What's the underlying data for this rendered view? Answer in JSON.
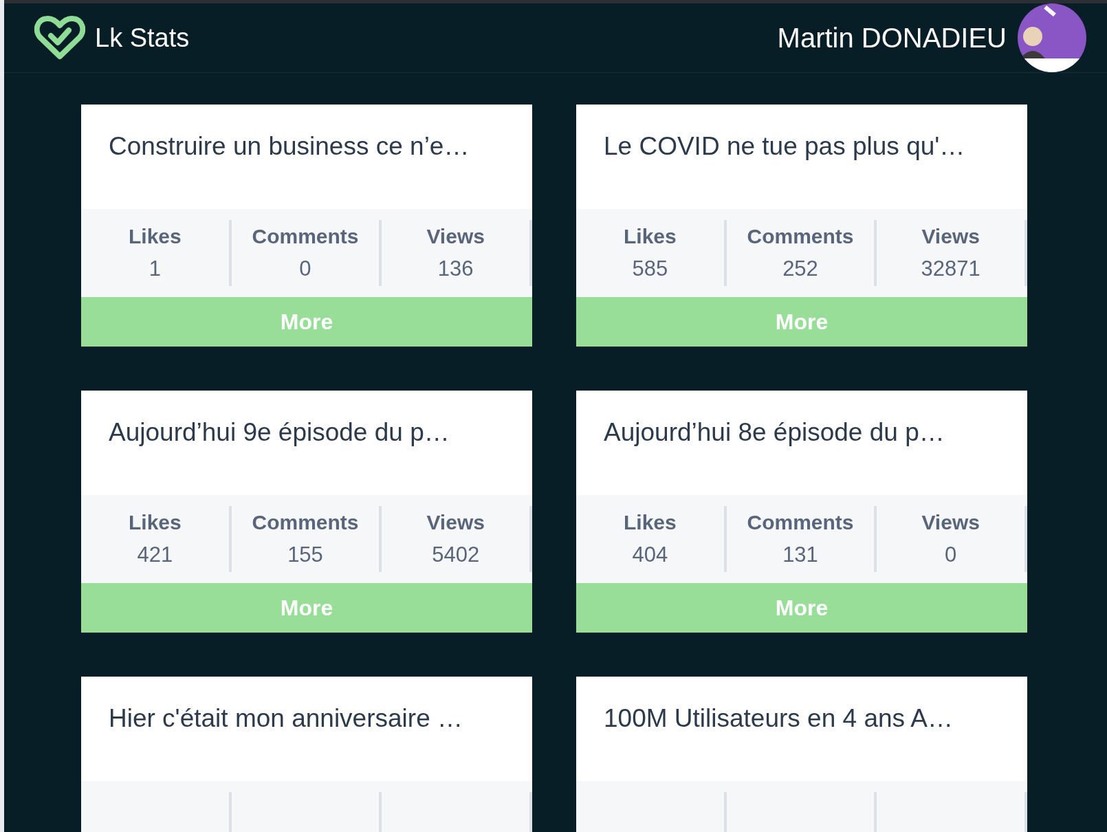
{
  "header": {
    "app_name": "Lk Stats",
    "user_name": "Martin DONADIEU"
  },
  "posts": [
    {
      "title": "Construire un business ce n’e…",
      "stats": [
        {
          "label": "Likes",
          "value": "1"
        },
        {
          "label": "Comments",
          "value": "0"
        },
        {
          "label": "Views",
          "value": "136"
        }
      ],
      "action": "More"
    },
    {
      "title": "Le COVID ne tue pas plus qu'…",
      "stats": [
        {
          "label": "Likes",
          "value": "585"
        },
        {
          "label": "Comments",
          "value": "252"
        },
        {
          "label": "Views",
          "value": "32871"
        }
      ],
      "action": "More"
    },
    {
      "title": "Aujourd’hui 9e épisode du p…",
      "stats": [
        {
          "label": "Likes",
          "value": "421"
        },
        {
          "label": "Comments",
          "value": "155"
        },
        {
          "label": "Views",
          "value": "5402"
        }
      ],
      "action": "More"
    },
    {
      "title": "Aujourd’hui 8e épisode du p…",
      "stats": [
        {
          "label": "Likes",
          "value": "404"
        },
        {
          "label": "Comments",
          "value": "131"
        },
        {
          "label": "Views",
          "value": "0"
        }
      ],
      "action": "More"
    },
    {
      "title": "Hier c'était mon anniversaire …"
    },
    {
      "title": "100M Utilisateurs en 4 ans A…"
    }
  ]
}
